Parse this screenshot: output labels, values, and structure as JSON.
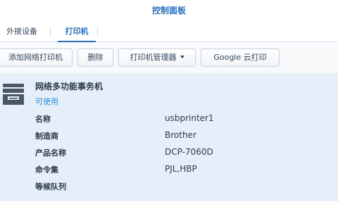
{
  "window": {
    "title": "控制面板"
  },
  "tabs": [
    {
      "label": "外接设备",
      "active": false
    },
    {
      "label": "打印机",
      "active": true
    }
  ],
  "toolbar": {
    "add_network_printer": "添加网络打印机",
    "delete": "删除",
    "printer_manager": "打印机管理器",
    "google_cloud_print": "Google 云打印"
  },
  "printer": {
    "name": "网络多功能事务机",
    "status": "可使用",
    "icon": "printer-icon",
    "fields": [
      {
        "label": "名称",
        "value": "usbprinter1"
      },
      {
        "label": "制造商",
        "value": "Brother"
      },
      {
        "label": "产品名称",
        "value": "DCP-7060D"
      },
      {
        "label": "命令集",
        "value": "PJL,HBP"
      },
      {
        "label": "等候队列",
        "value": ""
      }
    ]
  },
  "colors": {
    "accent": "#2a6fbd",
    "status": "#2a8fd4",
    "panel_bg": "#e6eff9"
  }
}
